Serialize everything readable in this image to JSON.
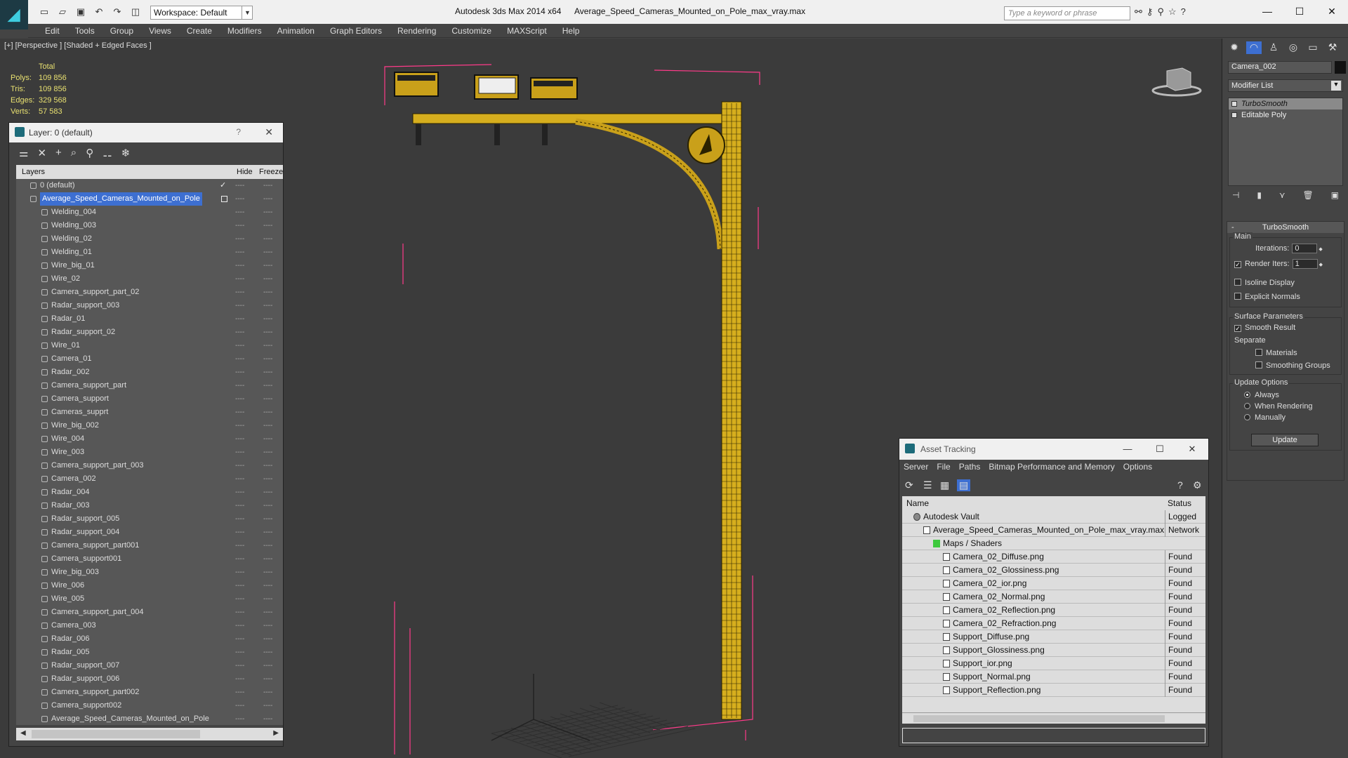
{
  "titlebar": {
    "app_title": "Autodesk 3ds Max  2014 x64",
    "file_title": "Average_Speed_Cameras_Mounted_on_Pole_max_vray.max",
    "workspace": "Workspace: Default",
    "search_placeholder": "Type a keyword or phrase",
    "help_label": "?"
  },
  "menus": [
    "Edit",
    "Tools",
    "Group",
    "Views",
    "Create",
    "Modifiers",
    "Animation",
    "Graph Editors",
    "Rendering",
    "Customize",
    "MAXScript",
    "Help"
  ],
  "viewport": {
    "label": "[+] [Perspective ] [Shaded + Edged Faces ]",
    "stats": {
      "total_label": "Total",
      "rows": [
        {
          "k": "Polys:",
          "v": "109 856"
        },
        {
          "k": "Tris:",
          "v": "109 856"
        },
        {
          "k": "Edges:",
          "v": "329 568"
        },
        {
          "k": "Verts:",
          "v": "57 583"
        }
      ]
    }
  },
  "layer_window": {
    "title": "Layer: 0 (default)",
    "help": "?",
    "col_layers": "Layers",
    "col_hide": "Hide",
    "col_freeze": "Freeze",
    "dots": "----",
    "layers": [
      {
        "name": "0 (default)",
        "level": 0,
        "check": "✓"
      },
      {
        "name": "Average_Speed_Cameras_Mounted_on_Pole",
        "level": 0,
        "selected": true
      }
    ],
    "objects": [
      "Welding_004",
      "Welding_003",
      "Welding_02",
      "Welding_01",
      "Wire_big_01",
      "Wire_02",
      "Camera_support_part_02",
      "Radar_support_003",
      "Radar_01",
      "Radar_support_02",
      "Wire_01",
      "Camera_01",
      "Radar_002",
      "Camera_support_part",
      "Camera_support",
      "Cameras_supprt",
      "Wire_big_002",
      "Wire_004",
      "Wire_003",
      "Camera_support_part_003",
      "Camera_002",
      "Radar_004",
      "Radar_003",
      "Radar_support_005",
      "Radar_support_004",
      "Camera_support_part001",
      "Camera_support001",
      "Wire_big_003",
      "Wire_006",
      "Wire_005",
      "Camera_support_part_004",
      "Camera_003",
      "Radar_006",
      "Radar_005",
      "Radar_support_007",
      "Radar_support_006",
      "Camera_support_part002",
      "Camera_support002",
      "Average_Speed_Cameras_Mounted_on_Pole"
    ]
  },
  "asset_tracking": {
    "title": "Asset Tracking",
    "menus": [
      "Server",
      "File",
      "Paths",
      "Bitmap Performance and Memory",
      "Options"
    ],
    "col_name": "Name",
    "col_status": "Status",
    "rows": [
      {
        "name": "Autodesk Vault",
        "status": "Logged",
        "indent": 1
      },
      {
        "name": "Average_Speed_Cameras_Mounted_on_Pole_max_vray.max",
        "status": "Network",
        "indent": 2
      },
      {
        "name": "Maps / Shaders",
        "status": "",
        "indent": 3
      },
      {
        "name": "Camera_02_Diffuse.png",
        "status": "Found",
        "indent": 4
      },
      {
        "name": "Camera_02_Glossiness.png",
        "status": "Found",
        "indent": 4
      },
      {
        "name": "Camera_02_ior.png",
        "status": "Found",
        "indent": 4
      },
      {
        "name": "Camera_02_Normal.png",
        "status": "Found",
        "indent": 4
      },
      {
        "name": "Camera_02_Reflection.png",
        "status": "Found",
        "indent": 4
      },
      {
        "name": "Camera_02_Refraction.png",
        "status": "Found",
        "indent": 4
      },
      {
        "name": "Support_Diffuse.png",
        "status": "Found",
        "indent": 4
      },
      {
        "name": "Support_Glossiness.png",
        "status": "Found",
        "indent": 4
      },
      {
        "name": "Support_ior.png",
        "status": "Found",
        "indent": 4
      },
      {
        "name": "Support_Normal.png",
        "status": "Found",
        "indent": 4
      },
      {
        "name": "Support_Reflection.png",
        "status": "Found",
        "indent": 4
      }
    ]
  },
  "command_panel": {
    "object_name": "Camera_002",
    "modifier_list": "Modifier List",
    "stack": [
      "TurboSmooth",
      "Editable Poly"
    ],
    "rollout_title": "TurboSmooth",
    "main_label": "Main",
    "iterations_label": "Iterations:",
    "iterations_value": "0",
    "render_iters_label": "Render Iters:",
    "render_iters_value": "1",
    "isoline_label": "Isoline Display",
    "explicit_normals_label": "Explicit Normals",
    "surface_params_label": "Surface Parameters",
    "smooth_result_label": "Smooth Result",
    "separate_label": "Separate",
    "materials_label": "Materials",
    "smoothing_groups_label": "Smoothing Groups",
    "update_options_label": "Update Options",
    "always_label": "Always",
    "when_rendering_label": "When Rendering",
    "manually_label": "Manually",
    "update_button": "Update"
  }
}
